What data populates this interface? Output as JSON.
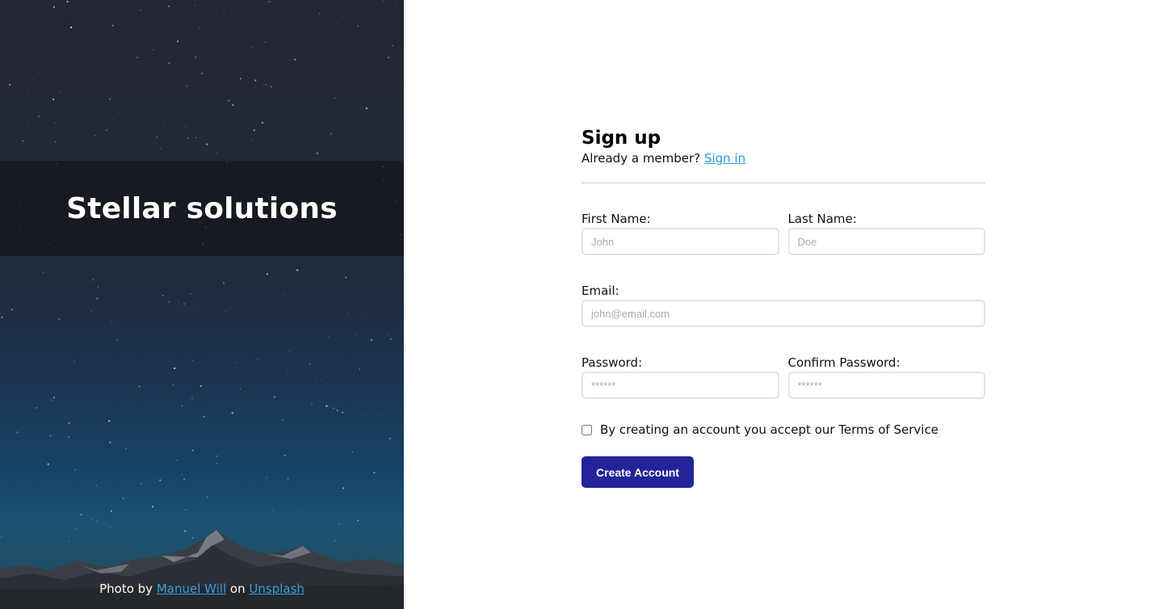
{
  "hero": {
    "brand_title": "Stellar solutions",
    "credit": {
      "prefix": "Photo by ",
      "author_link": "Manuel Will",
      "middle": " on ",
      "source_link": "Unsplash"
    }
  },
  "form": {
    "title": "Sign up",
    "subtitle_text": "Already a member? ",
    "signin_link": "Sign in",
    "first_name": {
      "label": "First Name:",
      "placeholder": "John",
      "value": ""
    },
    "last_name": {
      "label": "Last Name:",
      "placeholder": "Doe",
      "value": ""
    },
    "email": {
      "label": "Email:",
      "placeholder": "john@email.com",
      "value": ""
    },
    "password": {
      "label": "Password:",
      "placeholder": "******",
      "value": ""
    },
    "confirm_password": {
      "label": "Confirm Password:",
      "placeholder": "******",
      "value": ""
    },
    "terms_label": "By creating an account you accept our Terms of Service",
    "terms_checked": false,
    "submit_label": "Create Account"
  },
  "colors": {
    "accent_button": "#23239a",
    "link": "#2a9bd6",
    "hero_banner": "rgba(20,22,28,0.78)"
  }
}
